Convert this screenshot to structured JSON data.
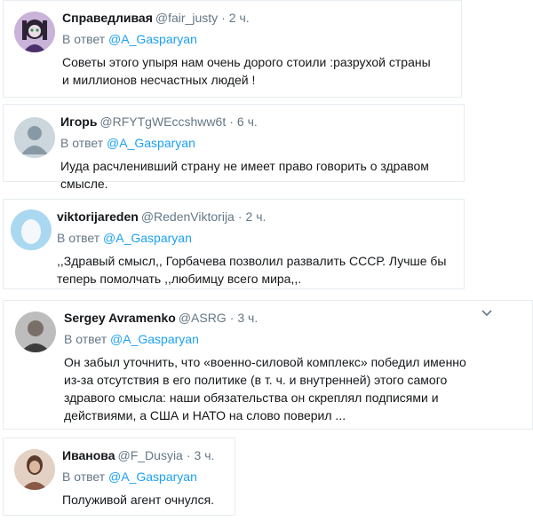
{
  "colors": {
    "link": "#1da1f2",
    "muted": "#657786",
    "text": "#14171a",
    "border": "#e6ecf0"
  },
  "tweets": [
    {
      "name": "Справедливая",
      "handle": "@fair_justy",
      "time": "2 ч.",
      "reply_prefix": "В ответ",
      "reply_to": "@A_Gasparyan",
      "text": "Советы этого упыря нам очень дорого стоили :разрухой страны и миллионов несчастных людей !",
      "avatar_icon": "cartoon-girl-avatar"
    },
    {
      "name": "Игорь",
      "handle": "@RFYTgWEccshww6t",
      "time": "6 ч.",
      "reply_prefix": "В ответ",
      "reply_to": "@A_Gasparyan",
      "text": "Иуда расчленивший страну не имеет право говорить о здравом смысле.",
      "avatar_icon": "default-user-avatar"
    },
    {
      "name": "viktorijareden",
      "handle": "@RedenViktorija",
      "time": "2 ч.",
      "reply_prefix": "В ответ",
      "reply_to": "@A_Gasparyan",
      "text": ",,Здравый смысл,, Горбачева позволил развалить СССР. Лучше бы теперь помолчать ,,любимцу всего мира,,.",
      "avatar_icon": "egg-avatar"
    },
    {
      "name": "Sergey Avramenko",
      "handle": "@ASRG",
      "time": "3 ч.",
      "reply_prefix": "В ответ",
      "reply_to": "@A_Gasparyan",
      "text": "Он забыл уточнить, что «военно-силовой комплекс» победил именно из-за отсутствия в его политике (в т. ч. и внутренней) этого самого здравого смысла: наши обязательства он скреплял подписями и действиями, а США и НАТО на слово поверил ...",
      "avatar_icon": "photo-man-avatar"
    },
    {
      "name": "Иванова",
      "handle": "@F_Dusyia",
      "time": "3 ч.",
      "reply_prefix": "В ответ",
      "reply_to": "@A_Gasparyan",
      "text": "Полуживой агент очнулся.",
      "avatar_icon": "photo-woman-avatar"
    }
  ]
}
